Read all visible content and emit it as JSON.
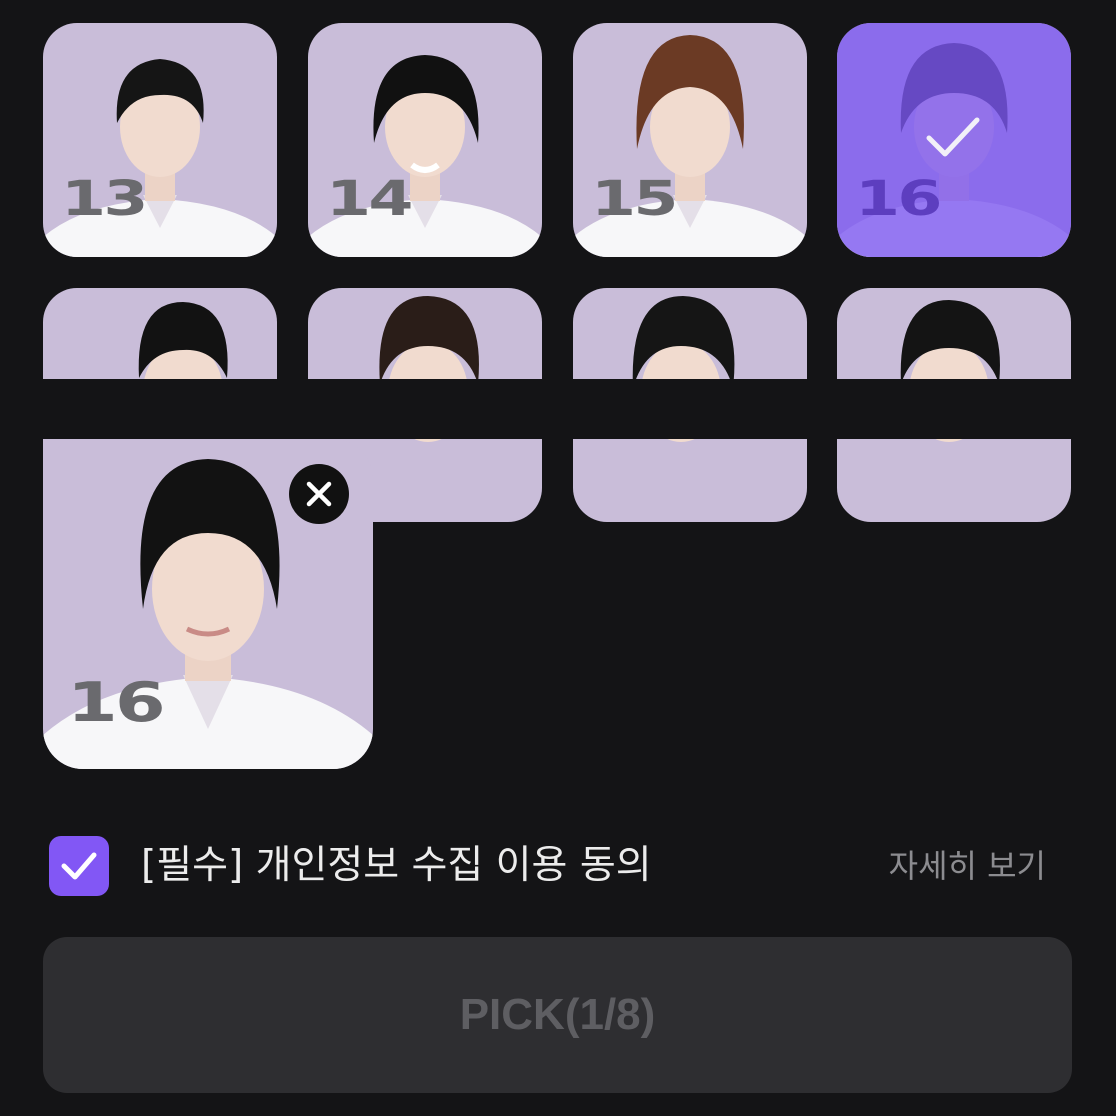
{
  "grid": {
    "tiles": [
      {
        "number": "13",
        "selected": false,
        "hair": "#151515"
      },
      {
        "number": "14",
        "selected": false,
        "hair": "#111111"
      },
      {
        "number": "15",
        "selected": false,
        "hair": "#6b3a24"
      },
      {
        "number": "16",
        "selected": true,
        "hair": "#121212"
      },
      {
        "number": "",
        "selected": false,
        "hair": "#121212"
      },
      {
        "number": "",
        "selected": false,
        "hair": "#2a1d18"
      },
      {
        "number": "",
        "selected": false,
        "hair": "#151515"
      },
      {
        "number": "",
        "selected": false,
        "hair": "#141414"
      }
    ]
  },
  "selection": {
    "card_number": "16",
    "remove_icon": "close-icon"
  },
  "consent": {
    "checked": true,
    "label": "[필수] 개인정보 수집 이용 동의",
    "detail_link": "자세히 보기"
  },
  "pick_button": {
    "label": "PICK(1/8)"
  },
  "colors": {
    "background": "#141416",
    "tile_bg": "#c9bdd9",
    "accent": "#8257f5",
    "button_bg": "#2e2e31"
  }
}
